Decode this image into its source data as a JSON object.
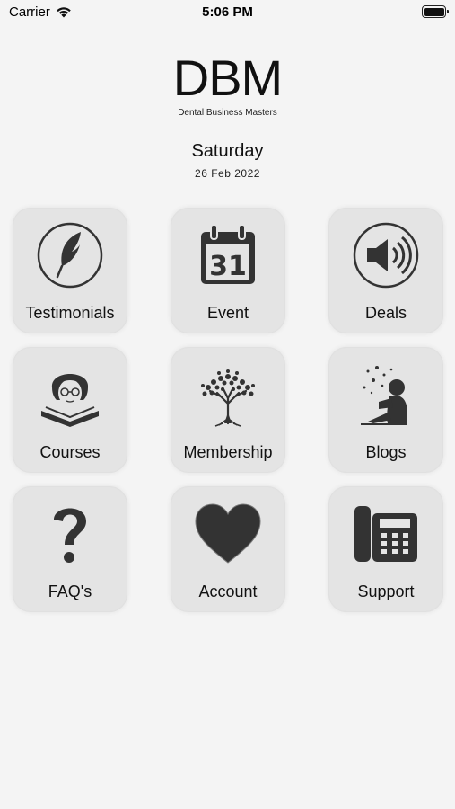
{
  "status_bar": {
    "carrier": "Carrier",
    "time": "5:06 PM"
  },
  "header": {
    "logo": "DBM",
    "subtitle": "Dental Business Masters"
  },
  "date": {
    "day": "Saturday",
    "full": "26 Feb 2022"
  },
  "tiles": [
    {
      "label": "Testimonials",
      "icon": "feather-icon"
    },
    {
      "label": "Event",
      "icon": "calendar-icon",
      "icon_text": "31"
    },
    {
      "label": "Deals",
      "icon": "speaker-icon"
    },
    {
      "label": "Courses",
      "icon": "reader-icon"
    },
    {
      "label": "Membership",
      "icon": "tree-icon"
    },
    {
      "label": "Blogs",
      "icon": "reading-child-icon"
    },
    {
      "label": "FAQ's",
      "icon": "question-icon"
    },
    {
      "label": "Account",
      "icon": "heart-icon"
    },
    {
      "label": "Support",
      "icon": "telephone-icon"
    }
  ]
}
